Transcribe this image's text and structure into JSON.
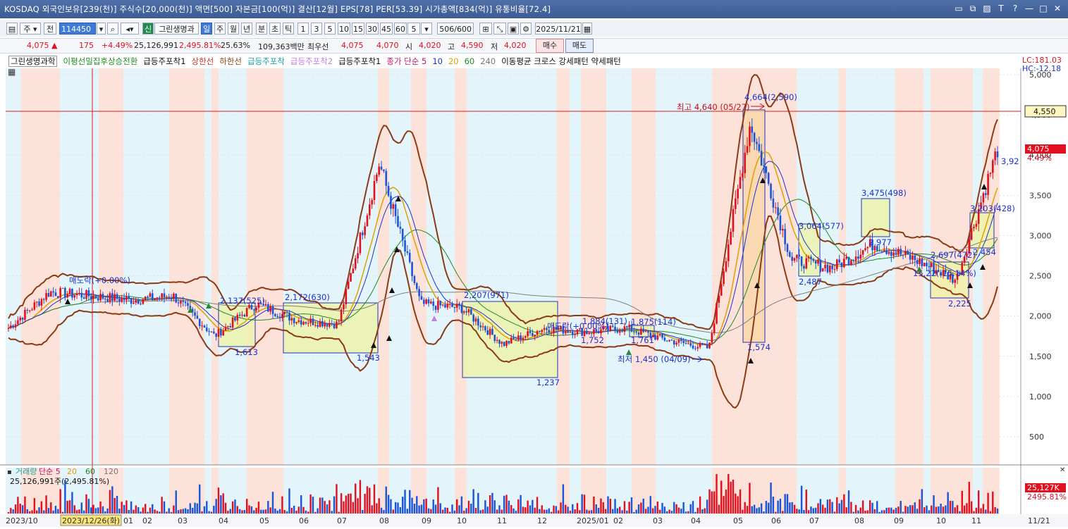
{
  "title_bar": {
    "text": "KOSDAQ 외국인보유[239(천)] 주식수[20,000(천)] 액면[500] 자본금[100(억)] 결산[12월] EPS[78] PER[53.39] 시가총액[834(억)] 유통비율[72.4]",
    "buttons": [
      "▭",
      "⧉",
      "▨",
      "T",
      "?",
      "—",
      "□",
      "✕"
    ]
  },
  "toolbar": {
    "mode1": "주",
    "mode2": "전",
    "code": "114450",
    "name_badge": "신",
    "name": "그린생명과",
    "periods": [
      "일",
      "주",
      "월",
      "년",
      "분",
      "초",
      "틱"
    ],
    "selected_period": "일",
    "intervals": [
      "1",
      "3",
      "5",
      "10",
      "15",
      "30",
      "45",
      "60"
    ],
    "interval_value": "5",
    "count": "506",
    "count_total": "/600",
    "date": "2025/11/21"
  },
  "quote": {
    "price": "4,075 ▲",
    "change": "175",
    "change_pct": "+4.49%",
    "volume": "25,126,991",
    "vol_ratio": "2,495.81%",
    "turnover": "25.63%",
    "amount": "109,363백만",
    "preferred": "최우선",
    "bid1": "4,075",
    "ask1": "4,070",
    "open_label": "시",
    "open": "4,020",
    "high_label": "고",
    "high": "4,590",
    "low_label": "저",
    "low": "4,020",
    "buy_btn": "매수",
    "sell_btn": "매도"
  },
  "legend": {
    "items": [
      {
        "text": "그린생명과학",
        "color": "#111111"
      },
      {
        "text": "이평선밀집후상승전환",
        "color": "#1f8a1f"
      },
      {
        "text": "급등주포착1",
        "color": "#111111"
      },
      {
        "text": "상한선",
        "color": "#c0392b"
      },
      {
        "text": "하한선",
        "color": "#8b4513"
      },
      {
        "text": "급등주포착",
        "color": "#18a0a0"
      },
      {
        "text": "급등주포착2",
        "color": "#c080e0"
      },
      {
        "text": "급등주포착1",
        "color": "#111111"
      },
      {
        "text": "종가 단순 5",
        "color": "#c0156b"
      },
      {
        "text": "10",
        "color": "#1a33cc"
      },
      {
        "text": "20",
        "color": "#e0a000"
      },
      {
        "text": "60",
        "color": "#1f8a1f"
      },
      {
        "text": "240",
        "color": "#777777"
      },
      {
        "text": "이동평균 크로스 강세패턴  약세패턴",
        "color": "#111111"
      }
    ]
  },
  "price_axis": {
    "ticks": [
      "5,000",
      "4,500",
      "4,000",
      "3,500",
      "3,000",
      "2,500",
      "2,000",
      "1,500",
      "1,000",
      "500"
    ],
    "lc": "LC:181.03",
    "hc": "HC:-12.18",
    "cursor_price": "4,550",
    "last_price": "4,075",
    "last_pct": "4.49%"
  },
  "annotations": {
    "high": "최고 4,640 (05/27)",
    "low": "최저 1,450 (04/09)",
    "labels": [
      "4,664(2,590)",
      "3,475(498)",
      "3,064(577)",
      "2,977",
      "2,697(472)",
      "3,203(428)",
      "2,454",
      "3,92",
      "2,487",
      "2,225",
      "15,22(-15.14%)",
      "2,137(525)",
      "2,172(630)",
      "2,207(971)",
      "1,884(131)",
      "1,875(114)",
      "1,752",
      "1,761",
      "1,574",
      "1,613",
      "1,543",
      "1,237",
      "매도락(+0.00%)",
      "매도락(+0.00%)"
    ]
  },
  "volume_panel": {
    "legend": [
      "거래량",
      "단순 5",
      "20",
      "60",
      "120"
    ],
    "info": "25,126,991주(2,495.81%)",
    "last": "25,127K",
    "last_pct": "2495.81%"
  },
  "x_axis": {
    "labels": [
      "2023/10",
      "2023/12/26(화)",
      "01",
      "02",
      "03",
      "04",
      "05",
      "06",
      "07",
      "08",
      "09",
      "10",
      "11",
      "12",
      "2025/01",
      "02",
      "03",
      "04",
      "05",
      "06",
      "07",
      "08",
      "09",
      "10",
      "11",
      "11/21"
    ]
  },
  "chart_data": {
    "type": "candlestick",
    "symbol": "그린생명과학",
    "ylim": [
      0,
      5000
    ],
    "approx_closes": [
      {
        "x": "2023/10",
        "y": 1850
      },
      {
        "x": "2023/12",
        "y": 2300
      },
      {
        "x": "2024/01",
        "y": 2250
      },
      {
        "x": "2024/02",
        "y": 2200
      },
      {
        "x": "2024/03",
        "y": 2250
      },
      {
        "x": "2024/04",
        "y": 1750
      },
      {
        "x": "2024/05",
        "y": 2150
      },
      {
        "x": "2024/06",
        "y": 1950
      },
      {
        "x": "2024/07",
        "y": 1900
      },
      {
        "x": "2024/08",
        "y": 3900
      },
      {
        "x": "2024/09",
        "y": 2150
      },
      {
        "x": "2024/10",
        "y": 2100
      },
      {
        "x": "2024/11",
        "y": 1650
      },
      {
        "x": "2024/12",
        "y": 1850
      },
      {
        "x": "2025/01",
        "y": 1800
      },
      {
        "x": "2025/02",
        "y": 1850
      },
      {
        "x": "2025/03",
        "y": 1700
      },
      {
        "x": "2025/04",
        "y": 1600
      },
      {
        "x": "2025/05",
        "y": 4400
      },
      {
        "x": "2025/06",
        "y": 2700
      },
      {
        "x": "2025/07",
        "y": 2600
      },
      {
        "x": "2025/08",
        "y": 2900
      },
      {
        "x": "2025/09",
        "y": 2700
      },
      {
        "x": "2025/10",
        "y": 2450
      },
      {
        "x": "2025/11",
        "y": 4075
      }
    ],
    "high": {
      "value": 4640,
      "date": "05/27"
    },
    "low": {
      "value": 1450,
      "date": "04/09"
    }
  }
}
